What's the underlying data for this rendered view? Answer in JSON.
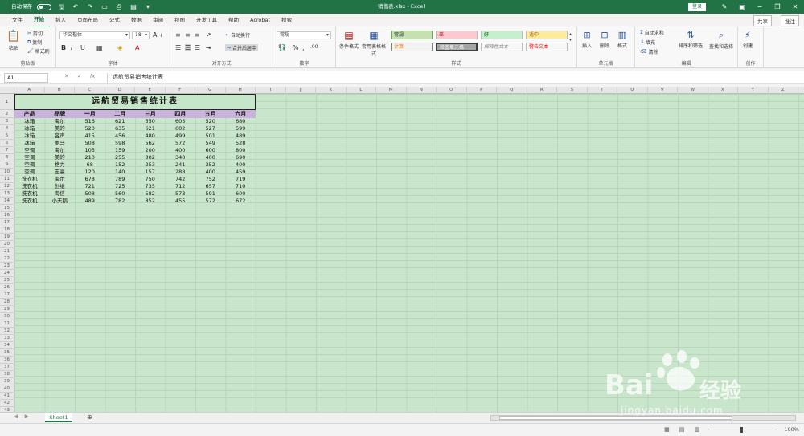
{
  "titlebar": {
    "autosave_label": "自动保存",
    "toggle_state": "关",
    "doc_title": "销售表.xlsx  -  Excel",
    "signin_label": "登录"
  },
  "menu": {
    "items": [
      "文件",
      "开始",
      "插入",
      "页面布局",
      "公式",
      "数据",
      "审阅",
      "视图",
      "开发工具",
      "帮助",
      "Acrobat",
      "搜索"
    ],
    "active": "开始",
    "share": "共享",
    "comment": "批注"
  },
  "ribbon": {
    "clipboard": {
      "paste": "粘贴",
      "cut": "剪切",
      "copy": "复制",
      "painter": "格式刷",
      "label": "剪贴板"
    },
    "font": {
      "name": "华文楷体",
      "size": "18",
      "label": "字体"
    },
    "alignment": {
      "wrap": "自动换行",
      "merge": "合并后居中",
      "label": "对齐方式"
    },
    "number": {
      "format": "常规",
      "label": "数字"
    },
    "styles": {
      "cond_format": "条件格式",
      "table_format": "套用表格格式",
      "cells": [
        "常规",
        "差",
        "好",
        "适中",
        "计算",
        "检查单元格",
        "解释性文本",
        "警告文本"
      ],
      "label": "样式"
    },
    "cells": {
      "insert": "插入",
      "delete": "删除",
      "format": "格式",
      "label": "单元格"
    },
    "editing": {
      "autosum": "自动求和",
      "fill": "填充",
      "clear": "清除",
      "sort": "排序和筛选",
      "find": "查找和选择",
      "label": "编辑"
    },
    "create": {
      "btn": "创建",
      "label": "创作"
    }
  },
  "formula_bar": {
    "cell_ref": "A1",
    "content": "远航贸易销售统计表"
  },
  "sheet": {
    "columns": [
      "A",
      "B",
      "C",
      "D",
      "E",
      "F",
      "G",
      "H",
      "I",
      "J",
      "K",
      "L",
      "M",
      "N",
      "O",
      "P",
      "Q",
      "R",
      "S",
      "T",
      "U",
      "V",
      "W",
      "X",
      "Y",
      "Z"
    ],
    "title": "远航贸易销售统计表",
    "headers": [
      "产品",
      "品牌",
      "一月",
      "二月",
      "三月",
      "四月",
      "五月",
      "六月"
    ],
    "rows": [
      [
        "冰箱",
        "海尔",
        "516",
        "621",
        "550",
        "605",
        "520",
        "680"
      ],
      [
        "冰箱",
        "美的",
        "520",
        "635",
        "621",
        "602",
        "527",
        "599"
      ],
      [
        "冰箱",
        "容声",
        "415",
        "456",
        "480",
        "499",
        "501",
        "489"
      ],
      [
        "冰箱",
        "奥马",
        "508",
        "598",
        "562",
        "572",
        "549",
        "528"
      ],
      [
        "空调",
        "海尔",
        "105",
        "159",
        "200",
        "400",
        "600",
        "800"
      ],
      [
        "空调",
        "美的",
        "210",
        "255",
        "302",
        "340",
        "400",
        "690"
      ],
      [
        "空调",
        "格力",
        "68",
        "152",
        "253",
        "241",
        "352",
        "400"
      ],
      [
        "空调",
        "志高",
        "120",
        "140",
        "157",
        "288",
        "400",
        "459"
      ],
      [
        "洗衣机",
        "海尔",
        "678",
        "789",
        "750",
        "742",
        "752",
        "719"
      ],
      [
        "洗衣机",
        "创维",
        "721",
        "725",
        "735",
        "712",
        "657",
        "710"
      ],
      [
        "洗衣机",
        "海信",
        "508",
        "560",
        "582",
        "573",
        "591",
        "600"
      ],
      [
        "洗衣机",
        "小天鹅",
        "489",
        "782",
        "852",
        "455",
        "572",
        "672"
      ]
    ],
    "tab": "Sheet1"
  },
  "status": {
    "zoom": "100%"
  },
  "watermark": {
    "brand": "Bai",
    "brand2": "经验",
    "url": "jingyan.baidu.com"
  }
}
